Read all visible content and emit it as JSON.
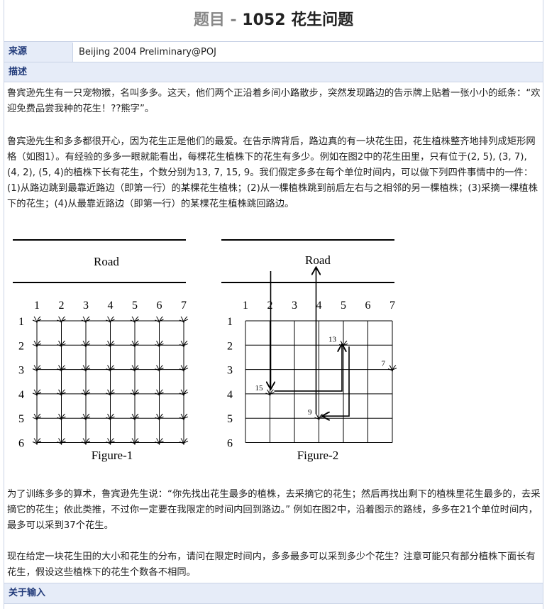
{
  "header": {
    "prefix": "题目 - ",
    "title": "1052 花生问题"
  },
  "source": {
    "label": "来源",
    "value": "Beijing 2004 Preliminary@POJ"
  },
  "description": {
    "label": "描述",
    "p1": "鲁宾逊先生有一只宠物猴，名叫多多。这天，他们两个正沿着乡间小路散步，突然发现路边的告示牌上贴着一张小小的纸条：“欢迎免费品尝我种的花生！??熊字”。",
    "p2": "鲁宾逊先生和多多都很开心，因为花生正是他们的最爱。在告示牌背后，路边真的有一块花生田，花生植株整齐地排列成矩形网格（如图1）。有经验的多多一眼就能看出，每棵花生植株下的花生有多少。例如在图2中的花生田里，只有位于(2, 5), (3, 7), (4, 2), (5, 4)的植株下长有花生，个数分别为13, 7, 15, 9。我们假定多多在每个单位时间内，可以做下列四件事情中的一件：(1)从路边跳到最靠近路边（即第一行）的某棵花生植株；(2)从一棵植株跳到前后左右与之相邻的另一棵植株；(3)采摘一棵植株下的花生；(4)从最靠近路边（即第一行）的某棵花生植株跳回路边。",
    "p3": "为了训练多多的算术，鲁宾逊先生说：“你先找出花生最多的植株，去采摘它的花生；然后再找出剩下的植株里花生最多的，去采摘它的花生；依此类推，不过你一定要在我限定的时间内回到路边。” 例如在图2中，沿着图示的路线，多多在21个单位时间内，最多可以采到37个花生。",
    "p4": "现在给定一块花生田的大小和花生的分布，请问在限定时间内，多多最多可以采到多少个花生？注意可能只有部分植株下面长有花生，假设这些植株下的花生个数各不相同。"
  },
  "input": {
    "label": "关于输入"
  },
  "figure": {
    "road_label": "Road",
    "fig1_caption": "Figure-1",
    "fig2_caption": "Figure-2",
    "col_labels": [
      "1",
      "2",
      "3",
      "4",
      "5",
      "6",
      "7"
    ],
    "row_labels": [
      "1",
      "2",
      "3",
      "4",
      "5",
      "6"
    ],
    "peanuts": [
      {
        "row": 2,
        "col": 5,
        "count": "13"
      },
      {
        "row": 3,
        "col": 7,
        "count": "7"
      },
      {
        "row": 4,
        "col": 2,
        "count": "15"
      },
      {
        "row": 5,
        "col": 4,
        "count": "9"
      }
    ]
  }
}
